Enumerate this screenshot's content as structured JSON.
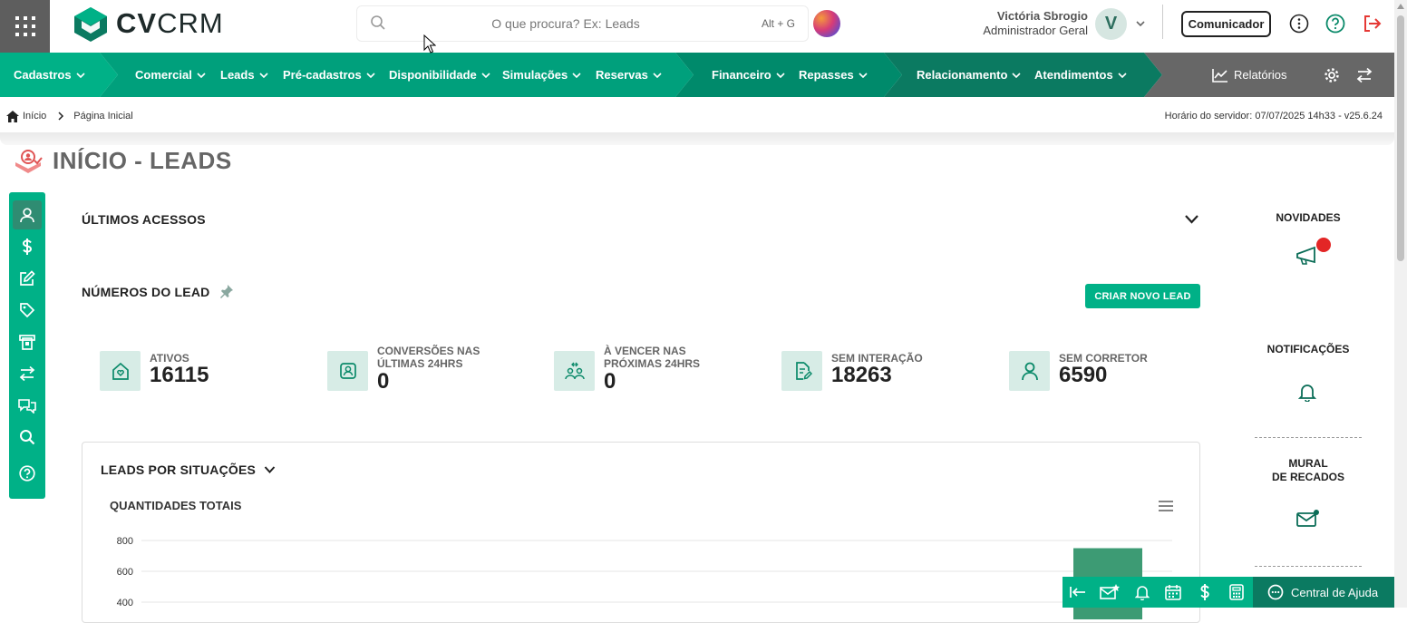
{
  "brand": {
    "name_bold": "CV",
    "name_rest": "CRM"
  },
  "search": {
    "placeholder": "O que procura? Ex: Leads",
    "shortcut": "Alt + G"
  },
  "user": {
    "name": "Victória Sbrogio",
    "role": "Administrador Geral",
    "initial": "V"
  },
  "top_actions": {
    "communicator_label": "Comunicador"
  },
  "nav": {
    "items": [
      {
        "label": "Cadastros"
      },
      {
        "label": "Comercial"
      },
      {
        "label": "Leads"
      },
      {
        "label": "Pré-cadastros"
      },
      {
        "label": "Disponibilidade"
      },
      {
        "label": "Simulações"
      },
      {
        "label": "Reservas"
      },
      {
        "label": "Financeiro"
      },
      {
        "label": "Repasses"
      },
      {
        "label": "Relacionamento"
      },
      {
        "label": "Atendimentos"
      }
    ],
    "reports_label": "Relatórios"
  },
  "breadcrumb": {
    "home": "Início",
    "current": "Página Inicial"
  },
  "server_time": "Horário do servidor: 07/07/2025 14h33 - v25.6.24",
  "page": {
    "title": "INÍCIO - LEADS"
  },
  "sections": {
    "recent_access": "ÚLTIMOS ACESSOS",
    "lead_numbers": "NÚMEROS DO LEAD",
    "create_lead_button": "CRIAR NOVO LEAD",
    "leads_by_status": "LEADS POR SITUAÇÕES",
    "totals_title": "QUANTIDADES TOTAIS"
  },
  "stats": [
    {
      "line1": "ATIVOS",
      "line2": "",
      "value": "16115"
    },
    {
      "line1": "CONVERSÕES NAS",
      "line2": "ÚLTIMAS 24HRS",
      "value": "0"
    },
    {
      "line1": "À VENCER NAS",
      "line2": "PRÓXIMAS 24HRS",
      "value": "0"
    },
    {
      "line1": "SEM INTERAÇÃO",
      "line2": "",
      "value": "18263"
    },
    {
      "line1": "SEM CORRETOR",
      "line2": "",
      "value": "6590"
    }
  ],
  "right_panel": {
    "news": "NOVIDADES",
    "notifications": "NOTIFICAÇÕES",
    "board_line1": "MURAL",
    "board_line2": "DE RECADOS"
  },
  "bottom_bar": {
    "help_label": "Central de Ajuda"
  },
  "chart_data": {
    "type": "bar",
    "title": "QUANTIDADES TOTAIS",
    "y_ticks": [
      400,
      600,
      800
    ],
    "ylim": [
      400,
      800
    ],
    "categories": [
      ""
    ],
    "values": [
      750
    ],
    "bar_color": "#3d9b74"
  },
  "colors": {
    "accent": "#00b187",
    "accent_dark": "#0b7a61",
    "danger": "#e53935"
  }
}
